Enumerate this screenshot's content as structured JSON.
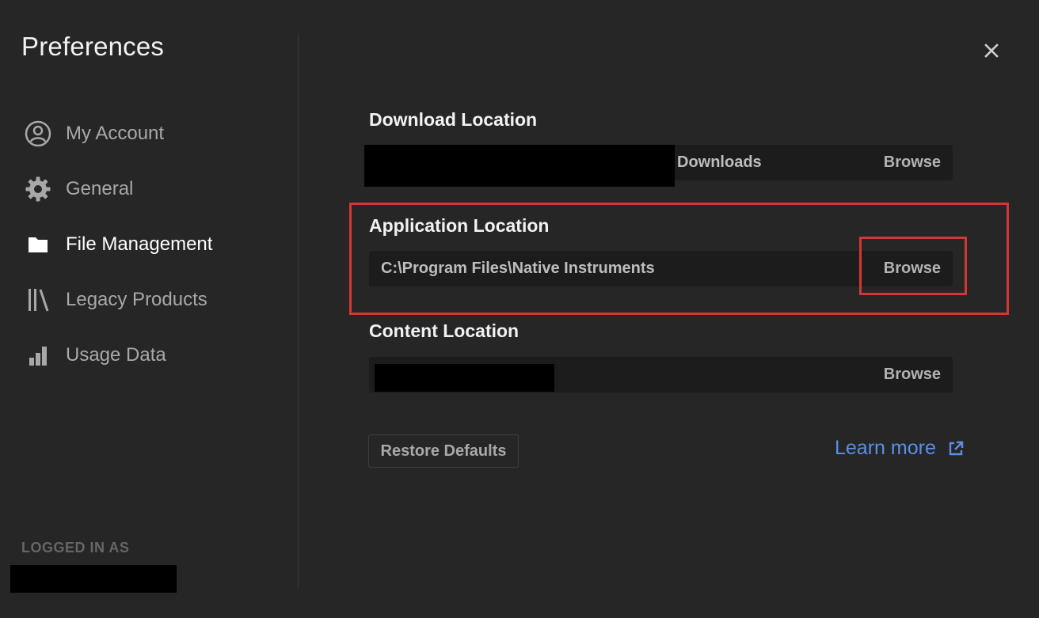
{
  "window": {
    "title": "Preferences",
    "close_icon": "close-icon"
  },
  "sidebar": {
    "items": [
      {
        "label": "My Account",
        "icon": "account-icon",
        "active": false
      },
      {
        "label": "General",
        "icon": "gear-icon",
        "active": false
      },
      {
        "label": "File Management",
        "icon": "folder-icon",
        "active": true
      },
      {
        "label": "Legacy Products",
        "icon": "library-icon",
        "active": false
      },
      {
        "label": "Usage Data",
        "icon": "bar-chart-icon",
        "active": false
      }
    ],
    "logged_in_label": "LOGGED IN AS"
  },
  "main": {
    "download": {
      "title": "Download Location",
      "value": "Downloads",
      "browse": "Browse"
    },
    "application": {
      "title": "Application Location",
      "value": "C:\\Program Files\\Native Instruments",
      "browse": "Browse"
    },
    "content": {
      "title": "Content Location",
      "value": "",
      "browse": "Browse"
    },
    "restore_label": "Restore Defaults",
    "learn_more_label": "Learn more"
  },
  "colors": {
    "background": "#262626",
    "field_background": "#1c1c1c",
    "highlight": "#d13834",
    "link": "#5c8fe6"
  }
}
